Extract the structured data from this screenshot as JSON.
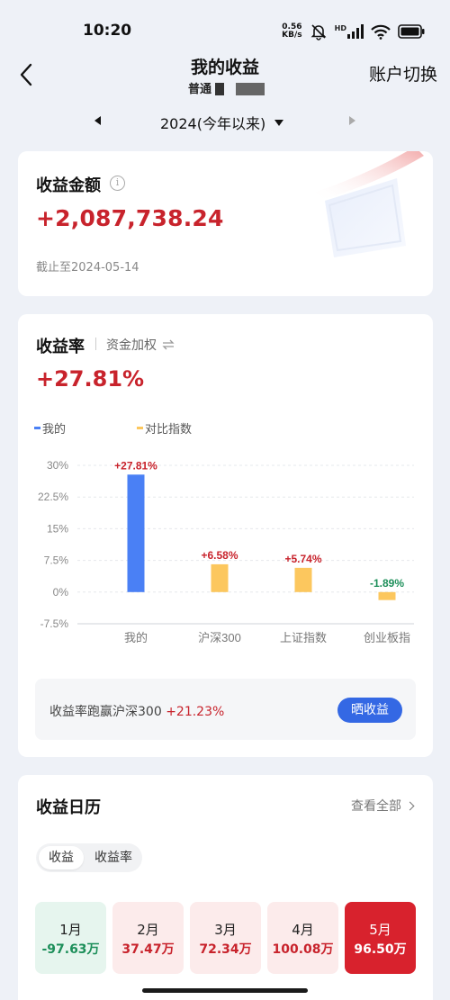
{
  "status": {
    "time": "10:20",
    "net_speed_value": "0.56",
    "net_speed_unit": "KB/s",
    "hd_label": "HD",
    "icons": [
      "mute-icon",
      "signal-icon",
      "wifi-icon",
      "battery-icon"
    ]
  },
  "nav": {
    "title": "我的收益",
    "subtitle": "普通",
    "right_label": "账户切换"
  },
  "year_selector": {
    "label": "2024(今年以来)"
  },
  "earnings": {
    "title": "收益金额",
    "info_glyph": "i",
    "amount": "+2,087,738.24",
    "as_of": "截止至2024-05-14"
  },
  "rate": {
    "title": "收益率",
    "weight_label": "资金加权",
    "value": "+27.81%",
    "legend": {
      "mine": "我的",
      "index": "对比指数"
    },
    "compare_text": "收益率跑赢沪深300",
    "compare_diff": "+21.23%",
    "share_button": "晒收益"
  },
  "chart_data": {
    "type": "bar",
    "categories": [
      "我的",
      "沪深300",
      "上证指数",
      "创业板指"
    ],
    "values": [
      27.81,
      6.58,
      5.74,
      -1.89
    ],
    "data_labels": [
      "+27.81%",
      "+6.58%",
      "+5.74%",
      "-1.89%"
    ],
    "yticks": [
      "30%",
      "22.5%",
      "15%",
      "7.5%",
      "0%",
      "-7.5%"
    ],
    "ytick_values": [
      30,
      22.5,
      15,
      7.5,
      0,
      -7.5
    ],
    "ylim": [
      -7.5,
      30
    ],
    "grid": true,
    "colors": {
      "mine": "#4a80f5",
      "index": "#fcc75e",
      "positive_label": "#c8232c",
      "negative_label": "#1d8f5a"
    }
  },
  "calendar": {
    "title": "收益日历",
    "view_all": "查看全部",
    "tabs": [
      "收益",
      "收益率"
    ],
    "months": [
      {
        "name": "1月",
        "value": "-97.63万"
      },
      {
        "name": "2月",
        "value": "37.47万"
      },
      {
        "name": "3月",
        "value": "72.34万"
      },
      {
        "name": "4月",
        "value": "100.08万"
      },
      {
        "name": "5月",
        "value": "96.50万"
      }
    ]
  },
  "colors": {
    "accent_red": "#c8232c",
    "accent_blue": "#3468e4",
    "background": "#eef1f7"
  }
}
